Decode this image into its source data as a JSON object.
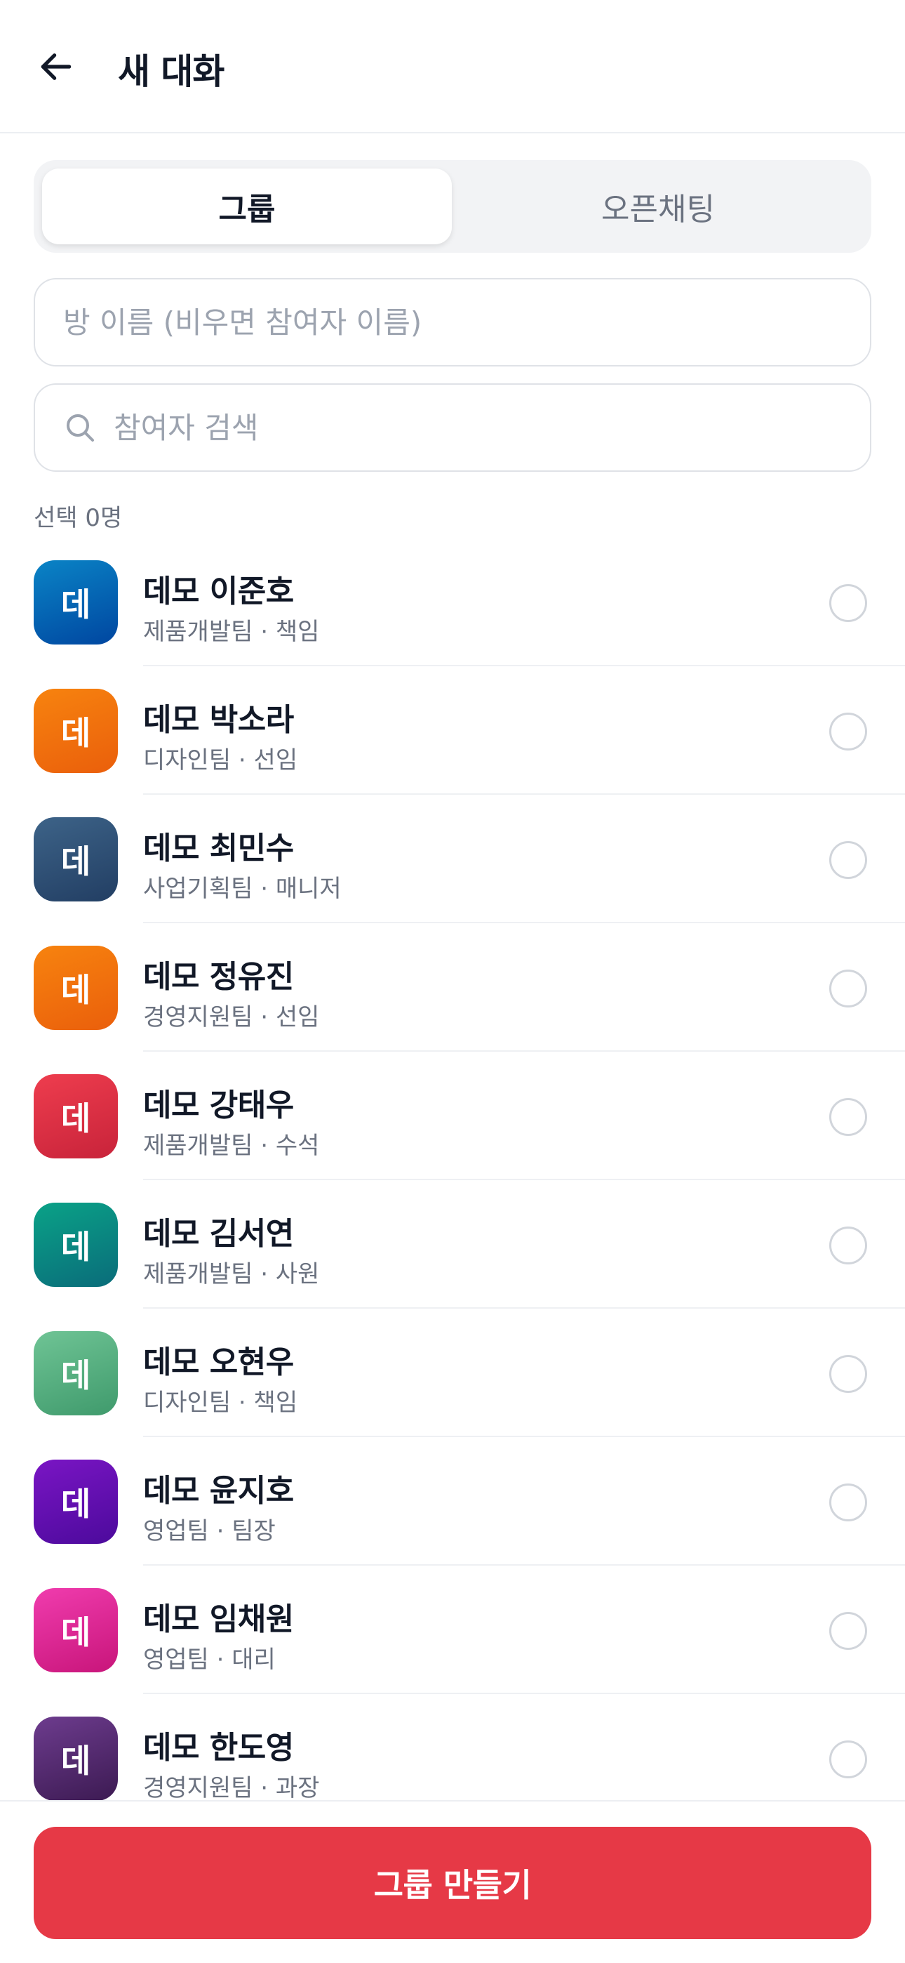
{
  "header": {
    "back_icon": "arrow-left-icon",
    "title": "새 대화"
  },
  "tabs": [
    {
      "label": "그룹",
      "active": true
    },
    {
      "label": "오픈채팅",
      "active": false
    }
  ],
  "room_name": {
    "value": "",
    "placeholder": "방 이름 (비우면 참여자 이름)"
  },
  "search": {
    "icon": "search-icon",
    "value": "",
    "placeholder": "참여자 검색"
  },
  "selected_count": "선택 0명",
  "participants": [
    {
      "avatar_text": "데",
      "name": "데모 이준호",
      "dept": "제품개발팀 · 책임",
      "color_from": "#0a84c6",
      "color_to": "#0046a0",
      "selected": false
    },
    {
      "avatar_text": "데",
      "name": "데모 박소라",
      "dept": "디자인팀 · 선임",
      "color_from": "#f7830e",
      "color_to": "#ea5f0c",
      "selected": false
    },
    {
      "avatar_text": "데",
      "name": "데모 최민수",
      "dept": "사업기획팀 · 매니저",
      "color_from": "#3d6388",
      "color_to": "#223e63",
      "selected": false
    },
    {
      "avatar_text": "데",
      "name": "데모 정유진",
      "dept": "경영지원팀 · 선임",
      "color_from": "#f7830e",
      "color_to": "#ea5f0c",
      "selected": false
    },
    {
      "avatar_text": "데",
      "name": "데모 강태우",
      "dept": "제품개발팀 · 수석",
      "color_from": "#ee3d4e",
      "color_to": "#c8233a",
      "selected": false
    },
    {
      "avatar_text": "데",
      "name": "데모 김서연",
      "dept": "제품개발팀 · 사원",
      "color_from": "#0aa287",
      "color_to": "#0a6c7a",
      "selected": false
    },
    {
      "avatar_text": "데",
      "name": "데모 오현우",
      "dept": "디자인팀 · 책임",
      "color_from": "#6fc495",
      "color_to": "#3f9a6c",
      "selected": false
    },
    {
      "avatar_text": "데",
      "name": "데모 윤지호",
      "dept": "영업팀 · 팀장",
      "color_from": "#7a15c4",
      "color_to": "#4c0a9c",
      "selected": false
    },
    {
      "avatar_text": "데",
      "name": "데모 임채원",
      "dept": "영업팀 · 대리",
      "color_from": "#f03cae",
      "color_to": "#c8157a",
      "selected": false
    },
    {
      "avatar_text": "데",
      "name": "데모 한도영",
      "dept": "경영지원팀 · 과장",
      "color_from": "#6d3c8e",
      "color_to": "#3c1a52",
      "selected": false
    }
  ],
  "create_button": "그룹 만들기"
}
